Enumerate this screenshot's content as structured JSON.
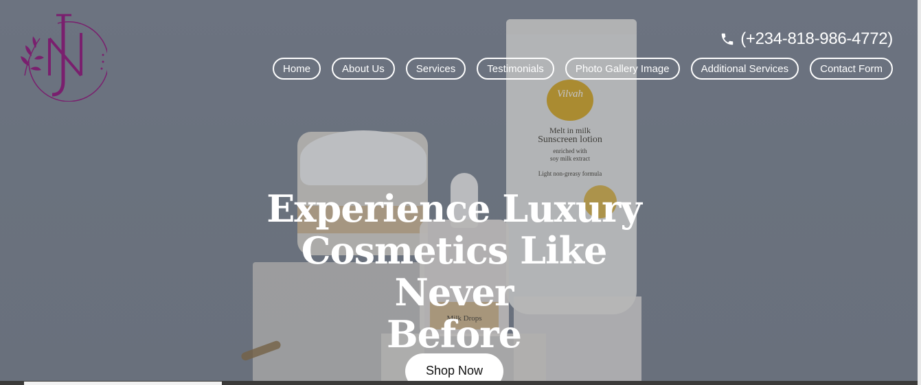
{
  "header": {
    "logo_icon": "nj-monogram-logo",
    "phone": "(+234-818-986-4772)",
    "phone_icon": "phone-icon"
  },
  "nav": {
    "items": [
      {
        "label": "Home"
      },
      {
        "label": "About Us"
      },
      {
        "label": "Services"
      },
      {
        "label": "Testimonials"
      },
      {
        "label": "Photo Gallery Image"
      },
      {
        "label": "Additional Services"
      },
      {
        "label": "Contact Form"
      }
    ]
  },
  "hero": {
    "headline_line1": "Experience Luxury",
    "headline_line2": "Cosmetics Like Never",
    "headline_line3": "Before",
    "cta_label": "Shop Now",
    "product": {
      "tube_brand": "Vilvah",
      "tube_line1": "Melt in milk",
      "tube_line2": "Sunscreen lotion",
      "tube_line3": "enriched with",
      "tube_line4": "soy milk extract",
      "tube_line5": "Light non-greasy formula",
      "dropper_label": "Milk Drops"
    }
  },
  "colors": {
    "accent_logo": "#7a1f6e",
    "nav_border": "#ffffff",
    "cta_bg": "#ffffff"
  }
}
